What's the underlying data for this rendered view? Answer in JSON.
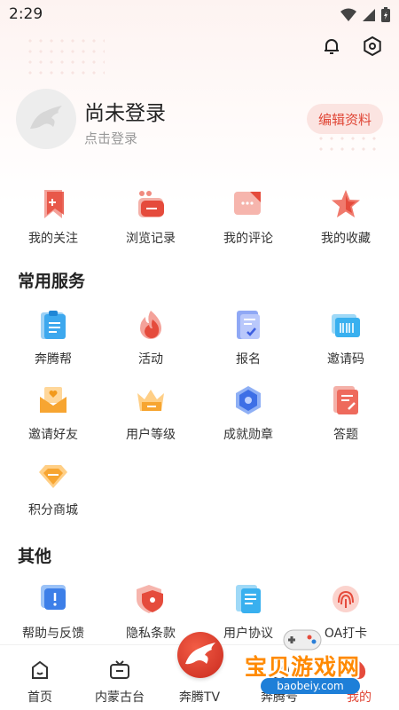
{
  "status_bar": {
    "time": "2:29"
  },
  "profile": {
    "name": "尚未登录",
    "subtitle": "点击登录",
    "edit_button": "编辑资料"
  },
  "quick_actions": [
    {
      "label": "我的关注",
      "icon": "bookmark-icon"
    },
    {
      "label": "浏览记录",
      "icon": "history-icon"
    },
    {
      "label": "我的评论",
      "icon": "comment-icon"
    },
    {
      "label": "我的收藏",
      "icon": "star-icon"
    }
  ],
  "common_services": {
    "title": "常用服务",
    "items": [
      {
        "label": "奔腾帮",
        "icon": "clipboard-icon"
      },
      {
        "label": "活动",
        "icon": "flame-icon"
      },
      {
        "label": "报名",
        "icon": "signup-form-icon"
      },
      {
        "label": "邀请码",
        "icon": "barcode-icon"
      },
      {
        "label": "邀请好友",
        "icon": "envelope-heart-icon"
      },
      {
        "label": "用户等级",
        "icon": "crown-icon"
      },
      {
        "label": "成就勋章",
        "icon": "medal-icon"
      },
      {
        "label": "答题",
        "icon": "quiz-icon"
      },
      {
        "label": "积分商城",
        "icon": "diamond-icon"
      }
    ]
  },
  "others": {
    "title": "其他",
    "items": [
      {
        "label": "帮助与反馈",
        "icon": "feedback-icon"
      },
      {
        "label": "隐私条款",
        "icon": "shield-icon"
      },
      {
        "label": "用户协议",
        "icon": "document-icon"
      },
      {
        "label": "OA打卡",
        "icon": "fingerprint-icon"
      }
    ]
  },
  "bottom_nav": [
    {
      "label": "首页",
      "icon": "home-icon"
    },
    {
      "label": "内蒙古台",
      "icon": "tv-icon"
    },
    {
      "label": "奔腾TV",
      "icon": "horse-logo-icon"
    },
    {
      "label": "奔腾号",
      "icon": "compass-icon"
    },
    {
      "label": "我的",
      "icon": "profile-icon"
    }
  ],
  "watermark": {
    "text": "宝贝游戏网",
    "url": "baobeiy.com"
  },
  "colors": {
    "accent": "#e04636",
    "accent_light": "#fbe4e1"
  }
}
